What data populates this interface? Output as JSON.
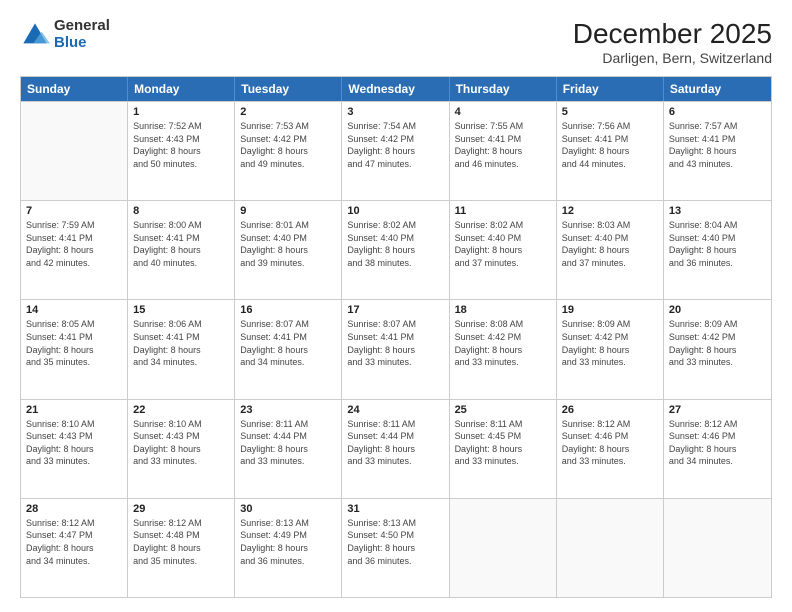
{
  "logo": {
    "general": "General",
    "blue": "Blue"
  },
  "title": "December 2025",
  "location": "Darligen, Bern, Switzerland",
  "days": [
    "Sunday",
    "Monday",
    "Tuesday",
    "Wednesday",
    "Thursday",
    "Friday",
    "Saturday"
  ],
  "weeks": [
    [
      {
        "date": "",
        "info": ""
      },
      {
        "date": "1",
        "info": "Sunrise: 7:52 AM\nSunset: 4:43 PM\nDaylight: 8 hours\nand 50 minutes."
      },
      {
        "date": "2",
        "info": "Sunrise: 7:53 AM\nSunset: 4:42 PM\nDaylight: 8 hours\nand 49 minutes."
      },
      {
        "date": "3",
        "info": "Sunrise: 7:54 AM\nSunset: 4:42 PM\nDaylight: 8 hours\nand 47 minutes."
      },
      {
        "date": "4",
        "info": "Sunrise: 7:55 AM\nSunset: 4:41 PM\nDaylight: 8 hours\nand 46 minutes."
      },
      {
        "date": "5",
        "info": "Sunrise: 7:56 AM\nSunset: 4:41 PM\nDaylight: 8 hours\nand 44 minutes."
      },
      {
        "date": "6",
        "info": "Sunrise: 7:57 AM\nSunset: 4:41 PM\nDaylight: 8 hours\nand 43 minutes."
      }
    ],
    [
      {
        "date": "7",
        "info": "Sunrise: 7:59 AM\nSunset: 4:41 PM\nDaylight: 8 hours\nand 42 minutes."
      },
      {
        "date": "8",
        "info": "Sunrise: 8:00 AM\nSunset: 4:41 PM\nDaylight: 8 hours\nand 40 minutes."
      },
      {
        "date": "9",
        "info": "Sunrise: 8:01 AM\nSunset: 4:40 PM\nDaylight: 8 hours\nand 39 minutes."
      },
      {
        "date": "10",
        "info": "Sunrise: 8:02 AM\nSunset: 4:40 PM\nDaylight: 8 hours\nand 38 minutes."
      },
      {
        "date": "11",
        "info": "Sunrise: 8:02 AM\nSunset: 4:40 PM\nDaylight: 8 hours\nand 37 minutes."
      },
      {
        "date": "12",
        "info": "Sunrise: 8:03 AM\nSunset: 4:40 PM\nDaylight: 8 hours\nand 37 minutes."
      },
      {
        "date": "13",
        "info": "Sunrise: 8:04 AM\nSunset: 4:40 PM\nDaylight: 8 hours\nand 36 minutes."
      }
    ],
    [
      {
        "date": "14",
        "info": "Sunrise: 8:05 AM\nSunset: 4:41 PM\nDaylight: 8 hours\nand 35 minutes."
      },
      {
        "date": "15",
        "info": "Sunrise: 8:06 AM\nSunset: 4:41 PM\nDaylight: 8 hours\nand 34 minutes."
      },
      {
        "date": "16",
        "info": "Sunrise: 8:07 AM\nSunset: 4:41 PM\nDaylight: 8 hours\nand 34 minutes."
      },
      {
        "date": "17",
        "info": "Sunrise: 8:07 AM\nSunset: 4:41 PM\nDaylight: 8 hours\nand 33 minutes."
      },
      {
        "date": "18",
        "info": "Sunrise: 8:08 AM\nSunset: 4:42 PM\nDaylight: 8 hours\nand 33 minutes."
      },
      {
        "date": "19",
        "info": "Sunrise: 8:09 AM\nSunset: 4:42 PM\nDaylight: 8 hours\nand 33 minutes."
      },
      {
        "date": "20",
        "info": "Sunrise: 8:09 AM\nSunset: 4:42 PM\nDaylight: 8 hours\nand 33 minutes."
      }
    ],
    [
      {
        "date": "21",
        "info": "Sunrise: 8:10 AM\nSunset: 4:43 PM\nDaylight: 8 hours\nand 33 minutes."
      },
      {
        "date": "22",
        "info": "Sunrise: 8:10 AM\nSunset: 4:43 PM\nDaylight: 8 hours\nand 33 minutes."
      },
      {
        "date": "23",
        "info": "Sunrise: 8:11 AM\nSunset: 4:44 PM\nDaylight: 8 hours\nand 33 minutes."
      },
      {
        "date": "24",
        "info": "Sunrise: 8:11 AM\nSunset: 4:44 PM\nDaylight: 8 hours\nand 33 minutes."
      },
      {
        "date": "25",
        "info": "Sunrise: 8:11 AM\nSunset: 4:45 PM\nDaylight: 8 hours\nand 33 minutes."
      },
      {
        "date": "26",
        "info": "Sunrise: 8:12 AM\nSunset: 4:46 PM\nDaylight: 8 hours\nand 33 minutes."
      },
      {
        "date": "27",
        "info": "Sunrise: 8:12 AM\nSunset: 4:46 PM\nDaylight: 8 hours\nand 34 minutes."
      }
    ],
    [
      {
        "date": "28",
        "info": "Sunrise: 8:12 AM\nSunset: 4:47 PM\nDaylight: 8 hours\nand 34 minutes."
      },
      {
        "date": "29",
        "info": "Sunrise: 8:12 AM\nSunset: 4:48 PM\nDaylight: 8 hours\nand 35 minutes."
      },
      {
        "date": "30",
        "info": "Sunrise: 8:13 AM\nSunset: 4:49 PM\nDaylight: 8 hours\nand 36 minutes."
      },
      {
        "date": "31",
        "info": "Sunrise: 8:13 AM\nSunset: 4:50 PM\nDaylight: 8 hours\nand 36 minutes."
      },
      {
        "date": "",
        "info": ""
      },
      {
        "date": "",
        "info": ""
      },
      {
        "date": "",
        "info": ""
      }
    ]
  ]
}
